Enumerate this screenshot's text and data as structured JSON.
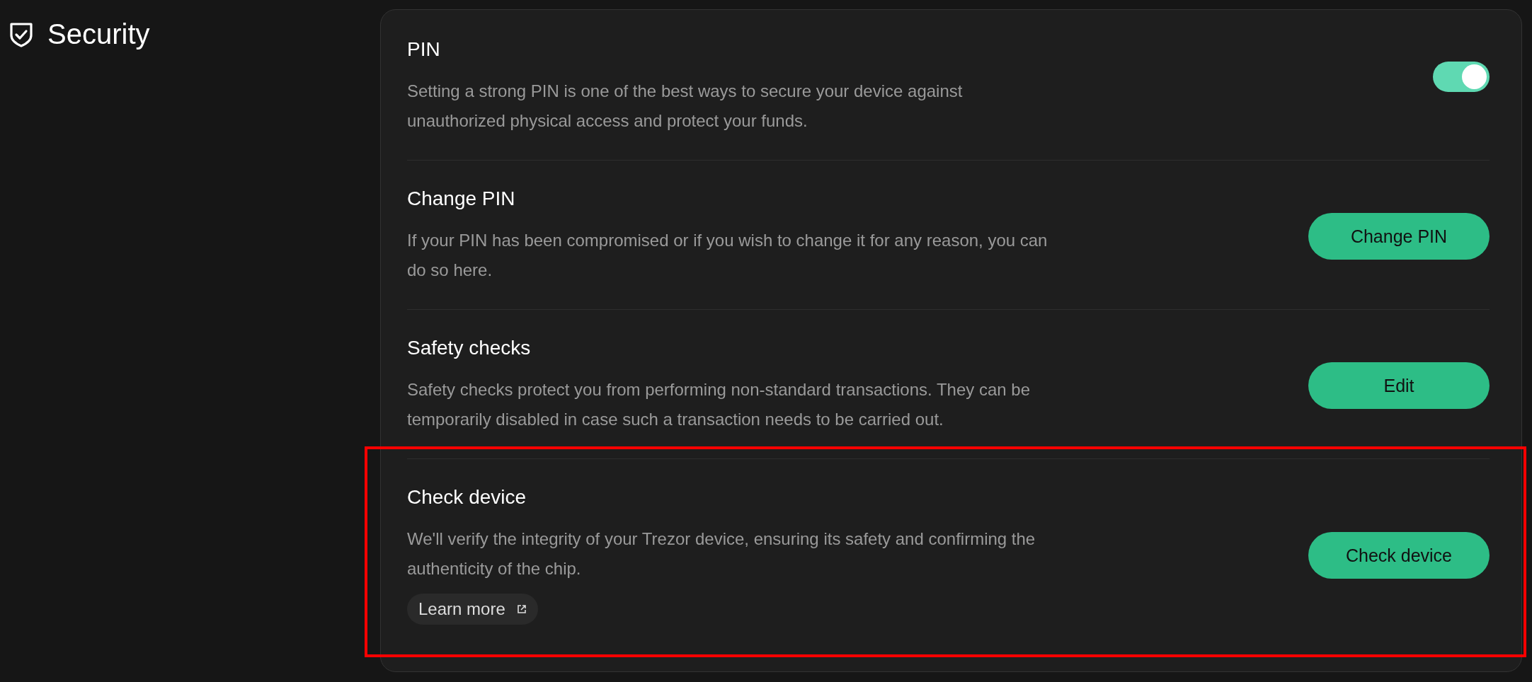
{
  "page": {
    "title": "Security"
  },
  "sections": [
    {
      "kind": "toggle",
      "title": "PIN",
      "description": "Setting a strong PIN is one of the best ways to secure your device against unauthorized physical access and protect your funds.",
      "on": true,
      "highlighted": false
    },
    {
      "kind": "button",
      "title": "Change PIN",
      "description": "If your PIN has been compromised or if you wish to change it for any reason, you can do so here.",
      "button": "Change PIN",
      "highlighted": false
    },
    {
      "kind": "button",
      "title": "Safety checks",
      "description": "Safety checks protect you from performing non-standard transactions. They can be temporarily disabled in case such a transaction needs to be carried out.",
      "button": "Edit",
      "highlighted": false
    },
    {
      "kind": "button",
      "title": "Check device",
      "description": "We'll verify the integrity of your Trezor device, ensuring its safety and confirming the authenticity of the chip.",
      "button": "Check device",
      "link": "Learn more",
      "highlighted": true
    }
  ]
}
